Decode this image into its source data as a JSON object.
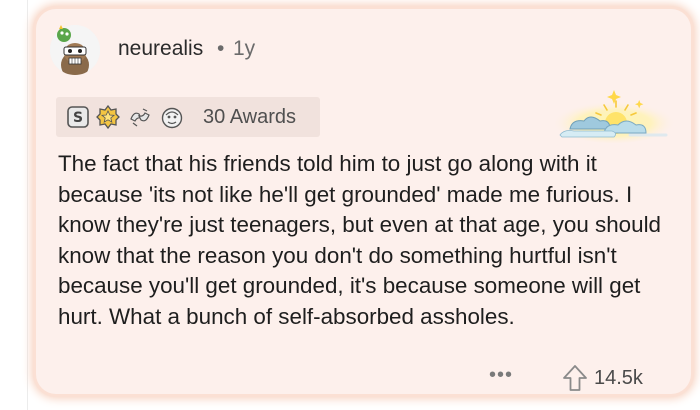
{
  "comment": {
    "username": "neurealis",
    "separator": "•",
    "age": "1y",
    "awards": {
      "count_label": "30 Awards",
      "icons": [
        "silver-award-icon",
        "gold-award-icon",
        "hands-award-icon",
        "face-award-icon"
      ]
    },
    "body": "The fact that his friends told him to just go along with it because 'its not like he'll get grounded' made me furious. I know they're just teenagers, but even at that age, you should know that the reason you don't do something hurtful isn't because you'll get grounded, it's because someone will get hurt. What a bunch of self-absorbed assholes.",
    "more_label": "•••",
    "score": "14.5k"
  },
  "colors": {
    "card_background": "#fdf0ec",
    "card_glow": "#f6cbb6",
    "text": "#1e1e1e",
    "meta_text": "#6b6b6b"
  }
}
